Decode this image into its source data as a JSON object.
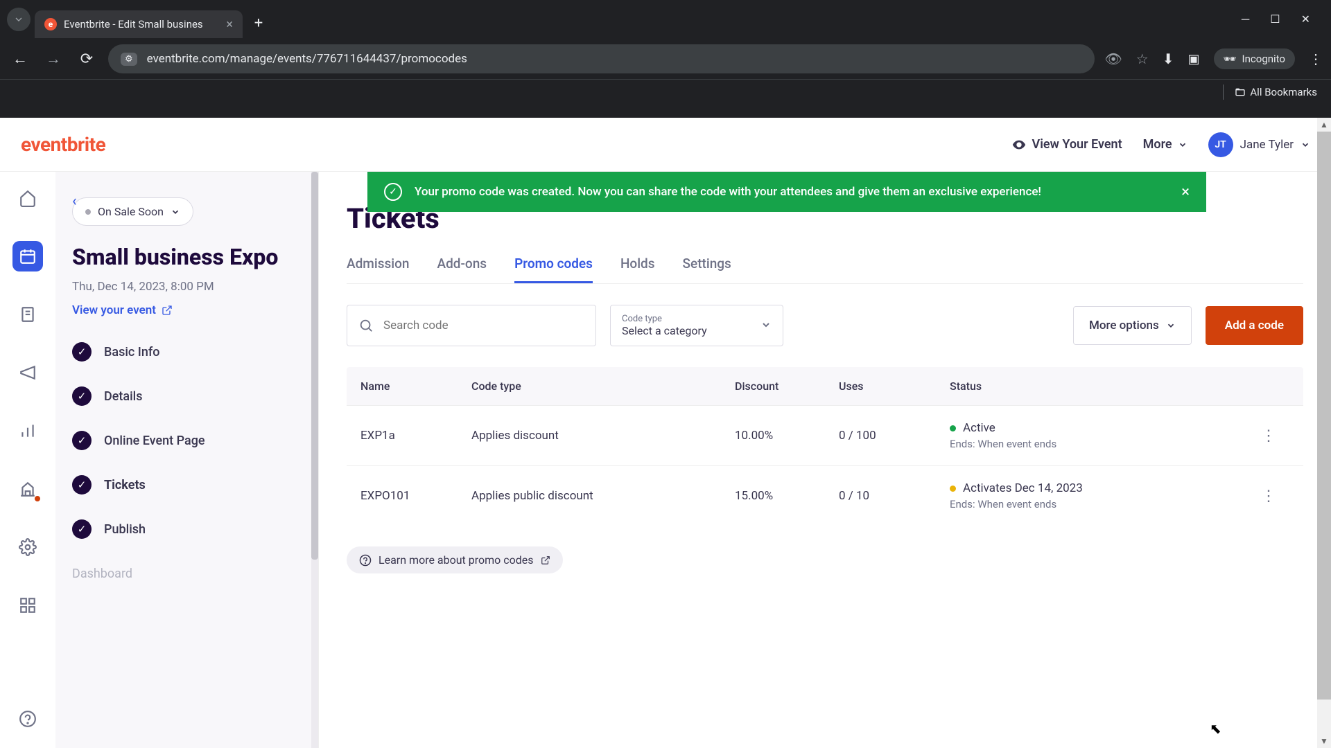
{
  "browser": {
    "tab_title": "Eventbrite - Edit Small busines",
    "url": "eventbrite.com/manage/events/776711644437/promocodes",
    "incognito_label": "Incognito",
    "all_bookmarks": "All Bookmarks"
  },
  "header": {
    "logo": "eventbrite",
    "view_event": "View Your Event",
    "more": "More",
    "user_initials": "JT",
    "user_name": "Jane Tyler"
  },
  "sidebar": {
    "sale_status": "On Sale Soon",
    "event_title": "Small business Expo",
    "event_date": "Thu, Dec 14, 2023, 8:00 PM",
    "view_event_link": "View your event",
    "steps": [
      {
        "label": "Basic Info"
      },
      {
        "label": "Details"
      },
      {
        "label": "Online Event Page"
      },
      {
        "label": "Tickets"
      },
      {
        "label": "Publish"
      }
    ],
    "dashboard_peek": "Dashboard"
  },
  "banner": {
    "text": "Your promo code was created. Now you can share the code with your attendees and give them an exclusive experience!"
  },
  "content": {
    "page_title": "Tickets",
    "tabs": [
      "Admission",
      "Add-ons",
      "Promo codes",
      "Holds",
      "Settings"
    ],
    "active_tab": 2,
    "search_placeholder": "Search code",
    "code_type_label": "Code type",
    "code_type_value": "Select a category",
    "more_options": "More options",
    "add_code": "Add a code",
    "columns": [
      "Name",
      "Code type",
      "Discount",
      "Uses",
      "Status"
    ],
    "rows": [
      {
        "name": "EXP1a",
        "code_type": "Applies discount",
        "discount": "10.00%",
        "uses": "0 / 100",
        "status_dot": "green",
        "status_main": "Active",
        "status_sub": "Ends: When event ends"
      },
      {
        "name": "EXPO101",
        "code_type": "Applies public discount",
        "discount": "15.00%",
        "uses": "0 / 10",
        "status_dot": "yellow",
        "status_main": "Activates Dec 14, 2023",
        "status_sub": "Ends: When event ends"
      }
    ],
    "learn_more": "Learn more about promo codes"
  }
}
